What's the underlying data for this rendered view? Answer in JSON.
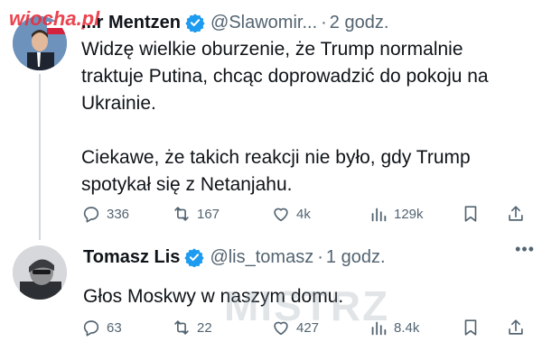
{
  "tweets": [
    {
      "name": "...r Mentzen",
      "handle": "@Slawomir...",
      "time": "2 godz.",
      "text_1": "Widzę wielkie oburzenie, że Trump normalnie traktuje Putina, chcąc doprowadzić do pokoju na Ukrainie.",
      "text_2": "Ciekawe, że takich reakcji nie było, gdy Trump spotykał się z Netanjahu.",
      "replies": "336",
      "reposts": "167",
      "likes": "4k",
      "views": "129k"
    },
    {
      "name": "Tomasz Lis",
      "handle": "@lis_tomasz",
      "time": "1 godz.",
      "text": "Głos Moskwy w naszym domu.",
      "replies": "63",
      "reposts": "22",
      "likes": "427",
      "views": "8.4k"
    }
  ],
  "watermarks": {
    "site": "wiocha.pl",
    "brand": "MISTRZ"
  },
  "colors": {
    "verified": "#1d9bf0",
    "muted": "#536471",
    "text": "#0f1419",
    "watermark": "#e8303c"
  }
}
